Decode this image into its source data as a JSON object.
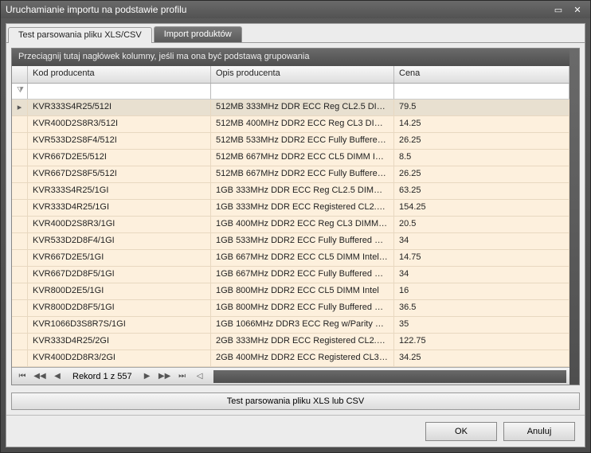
{
  "window": {
    "title": "Uruchamianie importu na podstawie profilu"
  },
  "tabs": [
    {
      "label": "Test parsowania pliku XLS/CSV",
      "active": true
    },
    {
      "label": "Import produktów",
      "active": false
    }
  ],
  "grid": {
    "group_hint": "Przeciągnij tutaj nagłówek kolumny, jeśli ma ona być podstawą grupowania",
    "columns": {
      "code": "Kod producenta",
      "desc": "Opis producenta",
      "price": "Cena"
    },
    "rows": [
      {
        "code": "KVR333S4R25/512I",
        "desc": "512MB 333MHz DDR ECC Reg CL2.5 DIMM ...",
        "price": "79.5",
        "selected": true
      },
      {
        "code": "KVR400D2S8R3/512I",
        "desc": "512MB 400MHz DDR2 ECC Reg CL3 DIMM S...",
        "price": "14.25"
      },
      {
        "code": "KVR533D2S8F4/512I",
        "desc": "512MB 533MHz DDR2 ECC Fully Buffered C...",
        "price": "26.25"
      },
      {
        "code": "KVR667D2E5/512I",
        "desc": "512MB 667MHz DDR2 ECC CL5 DIMM Intel ...",
        "price": "8.5"
      },
      {
        "code": "KVR667D2S8F5/512I",
        "desc": "512MB 667MHz DDR2 ECC Fully Buffered C...",
        "price": "26.25"
      },
      {
        "code": "KVR333S4R25/1GI",
        "desc": "1GB 333MHz DDR ECC Reg CL2.5 DIMM Sin...",
        "price": "63.25"
      },
      {
        "code": "KVR333D4R25/1GI",
        "desc": "1GB 333MHz DDR ECC Registered CL2.5 D...",
        "price": "154.25"
      },
      {
        "code": "KVR400D2S8R3/1GI",
        "desc": "1GB 400MHz DDR2 ECC Reg CL3 DIMM Sing...",
        "price": "20.5"
      },
      {
        "code": "KVR533D2D8F4/1GI",
        "desc": "1GB 533MHz DDR2 ECC Fully Buffered CL4 ...",
        "price": "34"
      },
      {
        "code": "KVR667D2E5/1GI",
        "desc": "1GB 667MHz DDR2 ECC CL5 DIMM Intel Vali...",
        "price": "14.75"
      },
      {
        "code": "KVR667D2D8F5/1GI",
        "desc": "1GB 667MHz DDR2 ECC Fully Buffered CL5 ...",
        "price": "34"
      },
      {
        "code": "KVR800D2E5/1GI",
        "desc": "1GB 800MHz DDR2 ECC CL5 DIMM Intel",
        "price": "16"
      },
      {
        "code": "KVR800D2D8F5/1GI",
        "desc": "1GB 800MHz DDR2 ECC Fully Buffered CL5 ...",
        "price": "36.5"
      },
      {
        "code": "KVR1066D3S8R7S/1GI",
        "desc": "1GB 1066MHz DDR3 ECC Reg w/Parity CL7 ...",
        "price": "35"
      },
      {
        "code": "KVR333D4R25/2GI",
        "desc": "2GB 333MHz DDR ECC Registered CL2.5 D...",
        "price": "122.75"
      },
      {
        "code": "KVR400D2D8R3/2GI",
        "desc": "2GB 400MHz DDR2 ECC Registered CL3 DI...",
        "price": "34.25"
      }
    ],
    "navigator": {
      "record_text": "Rekord 1 z 557"
    },
    "test_button": "Test parsowania pliku XLS lub CSV"
  },
  "footer": {
    "ok": "OK",
    "cancel": "Anuluj"
  }
}
